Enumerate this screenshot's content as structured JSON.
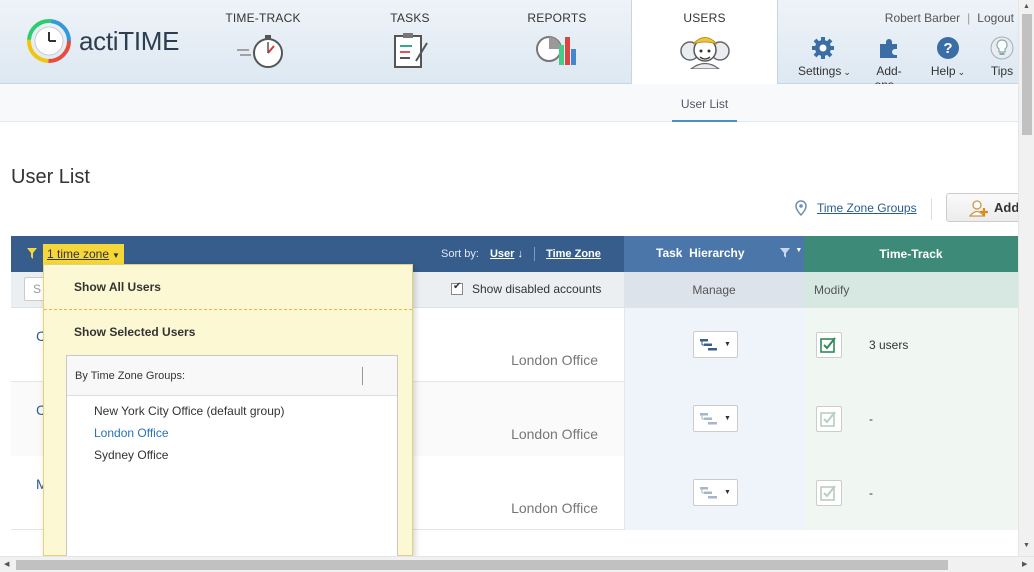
{
  "header": {
    "logo_text": "actiTIME",
    "tabs": [
      {
        "label": "TIME-TRACK"
      },
      {
        "label": "TASKS"
      },
      {
        "label": "REPORTS"
      },
      {
        "label": "USERS"
      }
    ],
    "user_name": "Robert Barber",
    "separator": "|",
    "logout": "Logout",
    "tools": [
      {
        "label": "Settings"
      },
      {
        "label": "Add-ons"
      },
      {
        "label": "Help"
      },
      {
        "label": "Tips"
      }
    ],
    "dropdown_caret": "⌄"
  },
  "subnav": {
    "active": "User List"
  },
  "page": {
    "title": "User List",
    "tz_groups_link": "Time Zone Groups",
    "add_button": "Add"
  },
  "table": {
    "tz_filter": "1 time zone",
    "sort_by_label": "Sort by:",
    "sort_user": "User",
    "sort_arrow": "↓",
    "sort_timezone": "Time Zone",
    "task_hierarchy": "Task  Hierarchy",
    "time_track": "Time-Track",
    "search_placeholder": "S",
    "show_disabled": "Show disabled accounts",
    "manage": "Manage",
    "modify": "Modify",
    "rows": [
      {
        "initial": "C",
        "office": "London Office",
        "modify_text": "3 users"
      },
      {
        "initial": "C",
        "office": "London Office",
        "modify_text": "-"
      },
      {
        "initial": "M",
        "office": "London Office",
        "modify_text": "-"
      }
    ]
  },
  "dropdown": {
    "show_all": "Show All Users",
    "show_selected": "Show Selected Users",
    "panel_title": "By Time Zone Groups:",
    "groups": [
      {
        "label": "New York City Office (default group)"
      },
      {
        "label": "London Office"
      },
      {
        "label": "Sydney Office"
      }
    ]
  },
  "colors": {
    "header_blue": "#365d8c",
    "task_blue": "#4a76aa",
    "timetrack_green": "#3d8a78",
    "filter_yellow": "#f5d73a",
    "link_blue": "#2a5d8f"
  }
}
